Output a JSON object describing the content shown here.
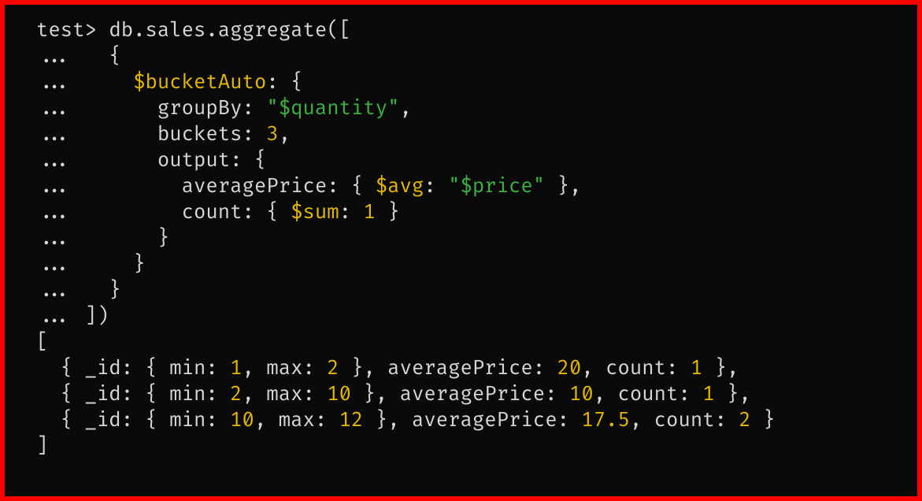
{
  "prompt": "test>",
  "continuation": "...",
  "command": "db.sales.aggregate([",
  "lines": {
    "l2": "   {",
    "l3a": "     ",
    "l3b": "$bucketAuto",
    "l3c": ": {",
    "l4a": "       groupBy: ",
    "l4b": "\"$quantity\"",
    "l4c": ",",
    "l5a": "       buckets: ",
    "l5b": "3",
    "l5c": ",",
    "l6a": "       output: {",
    "l7a": "         averagePrice: { ",
    "l7b": "$avg",
    "l7c": ": ",
    "l7d": "\"$price\"",
    "l7e": " },",
    "l8a": "         count: { ",
    "l8b": "$sum",
    "l8c": ": ",
    "l8d": "1",
    "l8e": " }",
    "l9": "       }",
    "l10": "     }",
    "l11": "   }",
    "l12": " ])"
  },
  "output": {
    "open": "[",
    "close": "]",
    "r1": {
      "a": "  { _id: { min: ",
      "b": "1",
      "c": ", max: ",
      "d": "2",
      "e": " }, averagePrice: ",
      "f": "20",
      "g": ", count: ",
      "h": "1",
      "i": " },"
    },
    "r2": {
      "a": "  { _id: { min: ",
      "b": "2",
      "c": ", max: ",
      "d": "10",
      "e": " }, averagePrice: ",
      "f": "10",
      "g": ", count: ",
      "h": "1",
      "i": " },"
    },
    "r3": {
      "a": "  { _id: { min: ",
      "b": "10",
      "c": ", max: ",
      "d": "12",
      "e": " }, averagePrice: ",
      "f": "17.5",
      "g": ", count: ",
      "h": "2",
      "i": " }"
    }
  }
}
